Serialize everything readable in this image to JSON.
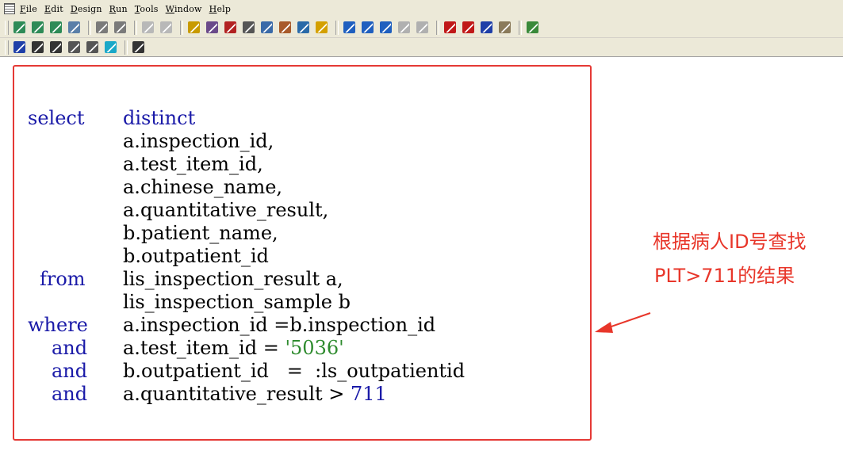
{
  "menu": [
    "File",
    "Edit",
    "Design",
    "Run",
    "Tools",
    "Window",
    "Help"
  ],
  "toolbar1_icons": [
    {
      "name": "new-icon",
      "color": "#2e8b57"
    },
    {
      "name": "open-icon",
      "color": "#2e8b57"
    },
    {
      "name": "save-icon",
      "color": "#2e8b57"
    },
    {
      "name": "preview-icon",
      "color": "#5a7fa8"
    },
    {
      "name": "layout-icon",
      "color": "#7a7a7a"
    },
    {
      "name": "grid-icon",
      "color": "#7a7a7a"
    },
    {
      "name": "disabled-a-icon",
      "color": "#b8b8b8"
    },
    {
      "name": "disabled-b-icon",
      "color": "#b8b8b8"
    },
    {
      "name": "ruler-icon",
      "color": "#c89a00"
    },
    {
      "name": "tools-icon",
      "color": "#6a4a8a"
    },
    {
      "name": "debug-icon",
      "color": "#b22222"
    },
    {
      "name": "library-icon",
      "color": "#555555"
    },
    {
      "name": "tree-icon",
      "color": "#3a6aa8"
    },
    {
      "name": "build-icon",
      "color": "#a85a2a"
    },
    {
      "name": "database-icon",
      "color": "#2a6aa8"
    },
    {
      "name": "edit-icon",
      "color": "#d4a000"
    },
    {
      "name": "chart-a-icon",
      "color": "#1f5fbf"
    },
    {
      "name": "chart-b-icon",
      "color": "#1f5fbf"
    },
    {
      "name": "chart-c-icon",
      "color": "#1f5fbf"
    },
    {
      "name": "chart-d-icon",
      "color": "#b0b0b0"
    },
    {
      "name": "chart-e-icon",
      "color": "#b0b0b0"
    },
    {
      "name": "stop-icon",
      "color": "#c01818"
    },
    {
      "name": "run-icon",
      "color": "#c01818"
    },
    {
      "name": "runner-icon",
      "color": "#1f3fa8"
    },
    {
      "name": "deploy-icon",
      "color": "#8a7a5a"
    },
    {
      "name": "exit-icon",
      "color": "#3a8a3a"
    }
  ],
  "toolbar2_icons": [
    {
      "name": "undo-icon",
      "color": "#1f3fa8"
    },
    {
      "name": "cut-icon",
      "color": "#333333"
    },
    {
      "name": "copy-icon",
      "color": "#333333"
    },
    {
      "name": "paste-icon",
      "color": "#555555"
    },
    {
      "name": "clear-icon",
      "color": "#555555"
    },
    {
      "name": "select-all-icon",
      "color": "#1aa8c8"
    },
    {
      "name": "properties-icon",
      "color": "#333333"
    }
  ],
  "code": {
    "line1_kw1": "select",
    "line1_kw2": "distinct",
    "line2": "a.inspection_id,",
    "line3": "a.test_item_id,",
    "line4": "a.chinese_name,",
    "line5": "a.quantitative_result,",
    "line6": "b.patient_name,",
    "line7": "b.outpatient_id",
    "line8_kw": "from",
    "line8": "lis_inspection_result a,",
    "line9": "lis_inspection_sample b",
    "line10_kw": "where",
    "line10": "a.inspection_id =b.inspection_id",
    "line11_kw": "and",
    "line11": "a.test_item_id = ",
    "line11_str": "'5036'",
    "line12_kw": "and",
    "line12": "b.outpatient_id   =  :ls_outpatientid",
    "line13_kw": "and",
    "line13": "a.quantitative_result > ",
    "line13_num": "711"
  },
  "annotation": {
    "line1": "根据病人ID号查找",
    "line2": "PLT>711的结果",
    "color": "#e8362a"
  }
}
